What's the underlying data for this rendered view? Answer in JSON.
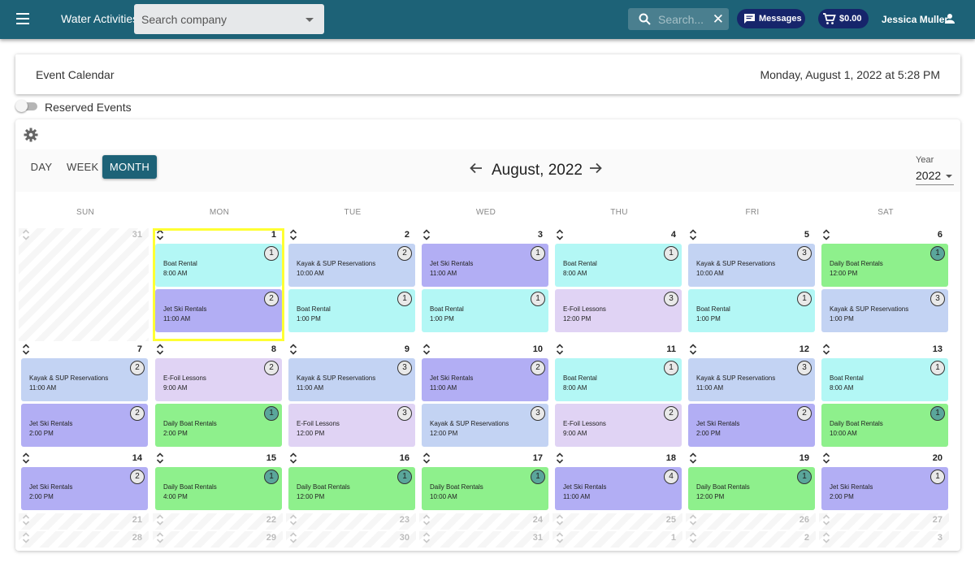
{
  "topbar": {
    "app_title": "Water Activities",
    "company_placeholder": "Search company",
    "search_placeholder": "Search...",
    "messages_label": "Messages",
    "cart_total": "$0.00",
    "user_name": "Jessica Muller"
  },
  "header": {
    "title": "Event Calendar",
    "datetime": "Monday, August 1, 2022 at 5:28 PM"
  },
  "reserved_toggle": {
    "label": "Reserved Events",
    "checked": false
  },
  "calendar": {
    "views": [
      "DAY",
      "WEEK",
      "MONTH"
    ],
    "active_view": "MONTH",
    "title": "August, 2022",
    "year_label": "Year",
    "year": "2022",
    "weekdays": [
      "SUN",
      "MON",
      "TUE",
      "WED",
      "THU",
      "FRI",
      "SAT"
    ],
    "weeks": [
      {
        "days": [
          {
            "num": "31",
            "faded": true,
            "events": []
          },
          {
            "num": "1",
            "today": true,
            "events": [
              {
                "name": "Boat Rental",
                "time": "8:00 AM",
                "count": "1",
                "kind": "boat"
              },
              {
                "name": "Jet Ski Rentals",
                "time": "11:00 AM",
                "count": "2",
                "kind": "jetski"
              }
            ]
          },
          {
            "num": "2",
            "events": [
              {
                "name": "Kayak & SUP Reservations",
                "time": "10:00 AM",
                "count": "2",
                "kind": "kayak"
              },
              {
                "name": "Boat Rental",
                "time": "1:00 PM",
                "count": "1",
                "kind": "boat"
              }
            ]
          },
          {
            "num": "3",
            "events": [
              {
                "name": "Jet Ski Rentals",
                "time": "11:00 AM",
                "count": "1",
                "kind": "jetski"
              },
              {
                "name": "Boat Rental",
                "time": "1:00 PM",
                "count": "1",
                "kind": "boat"
              }
            ]
          },
          {
            "num": "4",
            "events": [
              {
                "name": "Boat Rental",
                "time": "8:00 AM",
                "count": "1",
                "kind": "boat"
              },
              {
                "name": "E-Foil Lessons",
                "time": "12:00 PM",
                "count": "3",
                "kind": "efoil"
              }
            ]
          },
          {
            "num": "5",
            "events": [
              {
                "name": "Kayak & SUP Reservations",
                "time": "10:00 AM",
                "count": "3",
                "kind": "kayak"
              },
              {
                "name": "Boat Rental",
                "time": "1:00 PM",
                "count": "1",
                "kind": "boat"
              }
            ]
          },
          {
            "num": "6",
            "events": [
              {
                "name": "Daily Boat Rentals",
                "time": "12:00 PM",
                "count": "1",
                "kind": "daily"
              },
              {
                "name": "Kayak & SUP Reservations",
                "time": "1:00 PM",
                "count": "3",
                "kind": "kayak"
              }
            ]
          }
        ]
      },
      {
        "days": [
          {
            "num": "7",
            "events": [
              {
                "name": "Kayak & SUP Reservations",
                "time": "11:00 AM",
                "count": "2",
                "kind": "kayak"
              },
              {
                "name": "Jet Ski Rentals",
                "time": "2:00 PM",
                "count": "2",
                "kind": "jetski"
              }
            ]
          },
          {
            "num": "8",
            "events": [
              {
                "name": "E-Foil Lessons",
                "time": "9:00 AM",
                "count": "2",
                "kind": "efoil"
              },
              {
                "name": "Daily Boat Rentals",
                "time": "2:00 PM",
                "count": "1",
                "kind": "daily"
              }
            ]
          },
          {
            "num": "9",
            "events": [
              {
                "name": "Kayak & SUP Reservations",
                "time": "11:00 AM",
                "count": "3",
                "kind": "kayak"
              },
              {
                "name": "E-Foil Lessons",
                "time": "12:00 PM",
                "count": "3",
                "kind": "efoil"
              }
            ]
          },
          {
            "num": "10",
            "events": [
              {
                "name": "Jet Ski Rentals",
                "time": "11:00 AM",
                "count": "2",
                "kind": "jetski"
              },
              {
                "name": "Kayak & SUP Reservations",
                "time": "12:00 PM",
                "count": "3",
                "kind": "kayak"
              }
            ]
          },
          {
            "num": "11",
            "events": [
              {
                "name": "Boat Rental",
                "time": "8:00 AM",
                "count": "1",
                "kind": "boat"
              },
              {
                "name": "E-Foil Lessons",
                "time": "9:00 AM",
                "count": "2",
                "kind": "efoil"
              }
            ]
          },
          {
            "num": "12",
            "events": [
              {
                "name": "Kayak & SUP Reservations",
                "time": "11:00 AM",
                "count": "3",
                "kind": "kayak"
              },
              {
                "name": "Jet Ski Rentals",
                "time": "2:00 PM",
                "count": "2",
                "kind": "jetski"
              }
            ]
          },
          {
            "num": "13",
            "events": [
              {
                "name": "Boat Rental",
                "time": "8:00 AM",
                "count": "1",
                "kind": "boat"
              },
              {
                "name": "Daily Boat Rentals",
                "time": "10:00 AM",
                "count": "1",
                "kind": "daily"
              }
            ]
          }
        ]
      },
      {
        "days": [
          {
            "num": "14",
            "events": [
              {
                "name": "Jet Ski Rentals",
                "time": "2:00 PM",
                "count": "2",
                "kind": "jetski"
              }
            ]
          },
          {
            "num": "15",
            "events": [
              {
                "name": "Daily Boat Rentals",
                "time": "4:00 PM",
                "count": "1",
                "kind": "daily"
              }
            ]
          },
          {
            "num": "16",
            "events": [
              {
                "name": "Daily Boat Rentals",
                "time": "12:00 PM",
                "count": "1",
                "kind": "daily"
              }
            ]
          },
          {
            "num": "17",
            "events": [
              {
                "name": "Daily Boat Rentals",
                "time": "10:00 AM",
                "count": "1",
                "kind": "daily"
              }
            ]
          },
          {
            "num": "18",
            "events": [
              {
                "name": "Jet Ski Rentals",
                "time": "11:00 AM",
                "count": "4",
                "kind": "jetski"
              }
            ]
          },
          {
            "num": "19",
            "events": [
              {
                "name": "Daily Boat Rentals",
                "time": "12:00 PM",
                "count": "1",
                "kind": "daily"
              }
            ]
          },
          {
            "num": "20",
            "events": [
              {
                "name": "Jet Ski Rentals",
                "time": "2:00 PM",
                "count": "1",
                "kind": "jetski"
              }
            ]
          }
        ]
      },
      {
        "days": [
          {
            "num": "21",
            "faded": true,
            "events": []
          },
          {
            "num": "22",
            "faded": true,
            "events": []
          },
          {
            "num": "23",
            "faded": true,
            "events": []
          },
          {
            "num": "24",
            "faded": true,
            "events": []
          },
          {
            "num": "25",
            "faded": true,
            "events": []
          },
          {
            "num": "26",
            "faded": true,
            "events": []
          },
          {
            "num": "27",
            "faded": true,
            "events": []
          }
        ]
      },
      {
        "days": [
          {
            "num": "28",
            "faded": true,
            "events": []
          },
          {
            "num": "29",
            "faded": true,
            "events": []
          },
          {
            "num": "30",
            "faded": true,
            "events": []
          },
          {
            "num": "31",
            "faded": true,
            "events": []
          },
          {
            "num": "1",
            "faded": true,
            "events": []
          },
          {
            "num": "2",
            "faded": true,
            "events": []
          },
          {
            "num": "3",
            "faded": true,
            "events": []
          }
        ]
      }
    ]
  },
  "colors": {
    "topbar": "#1d6277",
    "boat": "#b3f7f5",
    "jetski": "#b2aef4",
    "kayak": "#c3d3f3",
    "efoil": "#e0d3f4",
    "daily": "#8ef08c",
    "today_outline": "#ffff33",
    "badge_dark": "#5aa69b"
  },
  "icons": [
    "menu-icon",
    "search-icon",
    "close-icon",
    "chat-icon",
    "cart-icon",
    "person-icon",
    "gear-icon",
    "arrow-left-icon",
    "arrow-right-icon",
    "chevron-updown-icon"
  ]
}
